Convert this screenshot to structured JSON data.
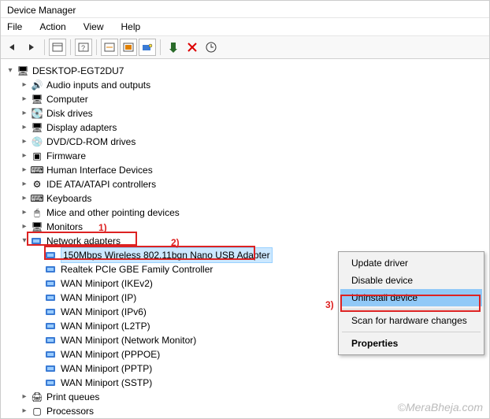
{
  "window": {
    "title": "Device Manager"
  },
  "menu": {
    "file": "File",
    "action": "Action",
    "view": "View",
    "help": "Help"
  },
  "root": {
    "name": "DESKTOP-EGT2DU7"
  },
  "categories": [
    {
      "label": "Audio inputs and outputs",
      "icon": "🔊"
    },
    {
      "label": "Computer",
      "icon": "🖥"
    },
    {
      "label": "Disk drives",
      "icon": "💽"
    },
    {
      "label": "Display adapters",
      "icon": "🖥"
    },
    {
      "label": "DVD/CD-ROM drives",
      "icon": "💿"
    },
    {
      "label": "Firmware",
      "icon": "▣"
    },
    {
      "label": "Human Interface Devices",
      "icon": "⌨"
    },
    {
      "label": "IDE ATA/ATAPI controllers",
      "icon": "⚙"
    },
    {
      "label": "Keyboards",
      "icon": "⌨"
    },
    {
      "label": "Mice and other pointing devices",
      "icon": "🖱"
    },
    {
      "label": "Monitors",
      "icon": "🖥"
    }
  ],
  "network": {
    "label": "Network adapters",
    "items": [
      "150Mbps Wireless 802.11bgn Nano USB Adapter",
      "Realtek PCIe GBE Family Controller",
      "WAN Miniport (IKEv2)",
      "WAN Miniport (IP)",
      "WAN Miniport (IPv6)",
      "WAN Miniport (L2TP)",
      "WAN Miniport (Network Monitor)",
      "WAN Miniport (PPPOE)",
      "WAN Miniport (PPTP)",
      "WAN Miniport (SSTP)"
    ]
  },
  "after": [
    {
      "label": "Print queues",
      "icon": "🖨"
    },
    {
      "label": "Processors",
      "icon": "▢"
    }
  ],
  "context_menu": {
    "update": "Update driver",
    "disable": "Disable device",
    "uninstall": "Uninstall device",
    "scan": "Scan for hardware changes",
    "properties": "Properties"
  },
  "annotations": {
    "a1": "1)",
    "a2": "2)",
    "a3": "3)"
  },
  "watermark": "©MeraBheja.com"
}
